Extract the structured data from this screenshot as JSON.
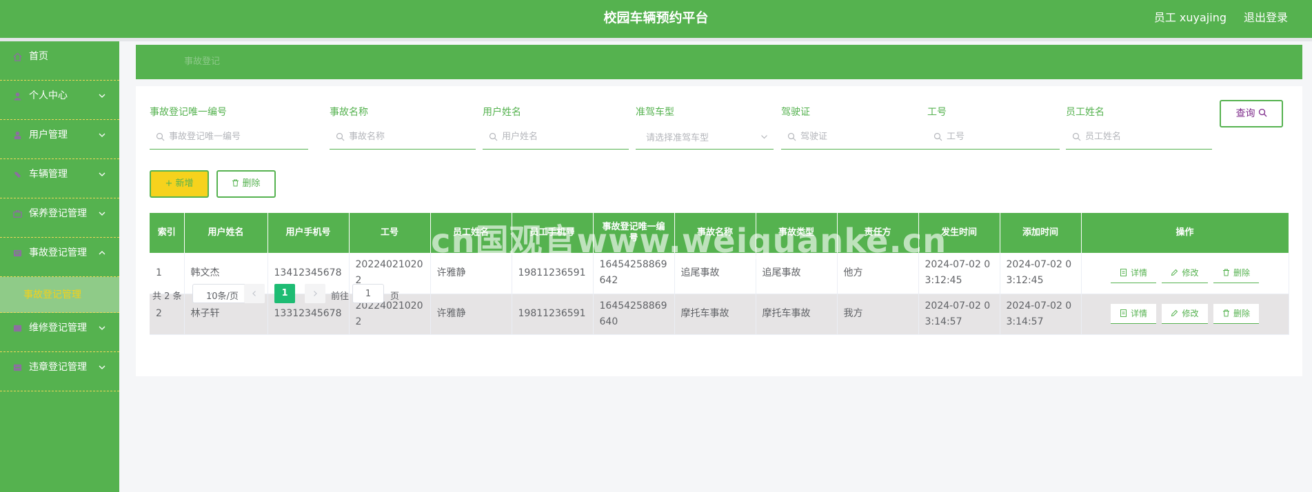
{
  "header": {
    "title": "校园车辆预约平台",
    "user": "员工 xuyajing",
    "logout": "退出登录"
  },
  "sidebar": {
    "items": [
      {
        "label": "首页",
        "icon": "home-icon",
        "expandable": false
      },
      {
        "label": "个人中心",
        "icon": "user-icon",
        "expandable": true
      },
      {
        "label": "用户管理",
        "icon": "user-manage-icon",
        "expandable": true
      },
      {
        "label": "车辆管理",
        "icon": "car-icon",
        "expandable": true
      },
      {
        "label": "保养登记管理",
        "icon": "maintenance-icon",
        "expandable": true
      },
      {
        "label": "事故登记管理",
        "icon": "accident-icon",
        "expandable": true,
        "expanded": true
      },
      {
        "label": "维修登记管理",
        "icon": "repair-icon",
        "expandable": true
      },
      {
        "label": "违章登记管理",
        "icon": "violation-icon",
        "expandable": true
      }
    ],
    "active_sub": "事故登记管理"
  },
  "breadcrumb": "事故登记",
  "search": {
    "fields": [
      {
        "label": "事故登记唯一编号",
        "placeholder": "事故登记唯一编号"
      },
      {
        "label": "事故名称",
        "placeholder": "事故名称"
      },
      {
        "label": "用户姓名",
        "placeholder": "用户姓名"
      },
      {
        "label": "准驾车型",
        "placeholder": "请选择准驾车型"
      },
      {
        "label": "驾驶证",
        "placeholder": "驾驶证"
      },
      {
        "label": "工号",
        "placeholder": "工号"
      },
      {
        "label": "员工姓名",
        "placeholder": "员工姓名"
      }
    ],
    "query_label": "查询"
  },
  "toolbar": {
    "add_label": "+ 新增",
    "delete_label": "删除"
  },
  "table": {
    "headers": [
      "索引",
      "用户姓名",
      "用户手机号",
      "工号",
      "员工姓名",
      "员工手机号",
      "事故登记唯一编号",
      "事故名称",
      "事故类型",
      "责任方",
      "发生时间",
      "添加时间",
      "操作"
    ],
    "rows": [
      [
        "1",
        "韩文杰",
        "13412345678",
        "202240210202",
        "许雅静",
        "19811236591",
        "16454258869642",
        "追尾事故",
        "追尾事故",
        "他方",
        "2024-07-02 03:12:45",
        "2024-07-02 03:12:45"
      ],
      [
        "2",
        "林子轩",
        "13312345678",
        "202240210202",
        "许雅静",
        "19811236591",
        "16454258869640",
        "摩托车事故",
        "摩托车事故",
        "我方",
        "2024-07-02 03:14:57",
        "2024-07-02 03:14:57"
      ]
    ],
    "ops": {
      "detail": "详情",
      "edit": "修改",
      "delete": "删除"
    }
  },
  "pagination": {
    "total": "共 2 条",
    "page_size": "10条/页",
    "current_page": "1",
    "goto_prefix": "前往",
    "goto_value": "1",
    "goto_suffix": "页"
  },
  "watermark": "cn国观官www.weiguanke.cn",
  "colors": {
    "primary": "#55b24f",
    "accent": "#f6d21d",
    "page_active": "#1ebc73",
    "row_alt": "#e6e4e5"
  }
}
